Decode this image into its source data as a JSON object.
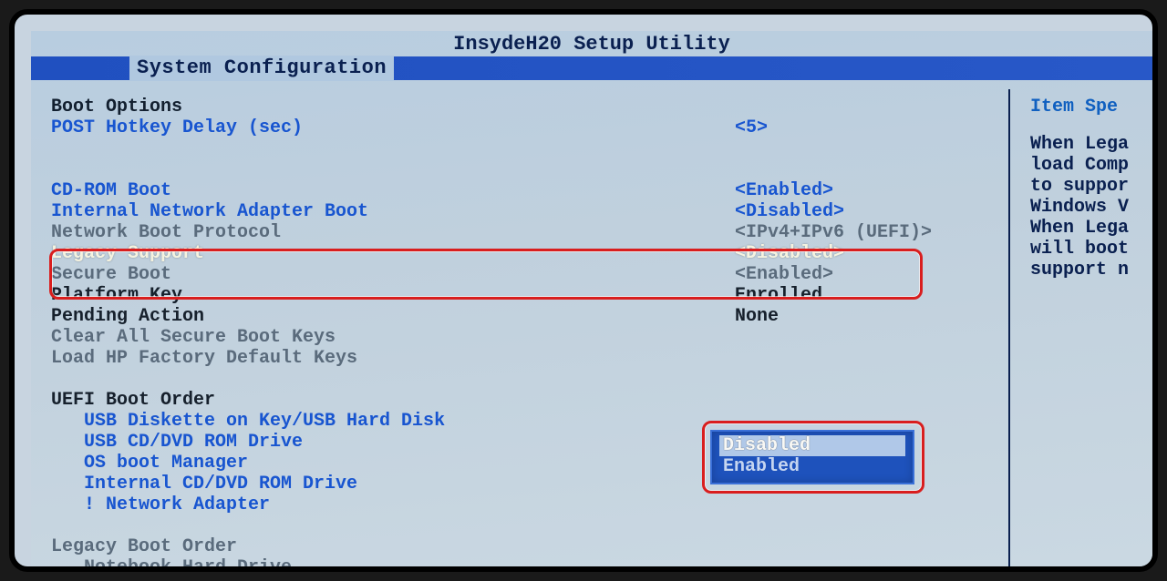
{
  "title": "InsydeH20 Setup Utility",
  "active_tab": "System Configuration",
  "help": {
    "title": "Item Spe",
    "lines": [
      "When Lega",
      "load Comp",
      "to suppor",
      "Windows V",
      "When Lega",
      "will boot",
      "support n"
    ]
  },
  "popup": {
    "selected": "Disabled",
    "other": "Enabled"
  },
  "rows": {
    "boot_options": "Boot Options",
    "post_hotkey": {
      "label": "POST Hotkey Delay (sec)",
      "value": "<5>"
    },
    "cdrom": {
      "label": "CD-ROM Boot",
      "value": "<Enabled>"
    },
    "netadapter": {
      "label": "Internal Network Adapter Boot",
      "value": "<Disabled>"
    },
    "netproto": {
      "label": "Network Boot Protocol",
      "value": "<IPv4+IPv6 (UEFI)>"
    },
    "legacy": {
      "label": "Legacy Support",
      "value": "<Disabled>"
    },
    "secure": {
      "label": "Secure Boot",
      "value": "<Enabled>"
    },
    "platkey": {
      "label": "Platform Key",
      "value": "Enrolled"
    },
    "pending": {
      "label": "Pending Action",
      "value": "None"
    },
    "clearkeys": "Clear All Secure Boot Keys",
    "loadhp": "Load HP Factory Default Keys",
    "uefi_order": "UEFI Boot Order",
    "uefi_items": [
      "USB Diskette on Key/USB Hard Disk",
      "USB CD/DVD ROM Drive",
      "OS boot Manager",
      "Internal CD/DVD ROM Drive",
      "! Network Adapter"
    ],
    "legacy_order": "Legacy Boot Order",
    "legacy_items": [
      "Notebook Hard Drive"
    ]
  }
}
